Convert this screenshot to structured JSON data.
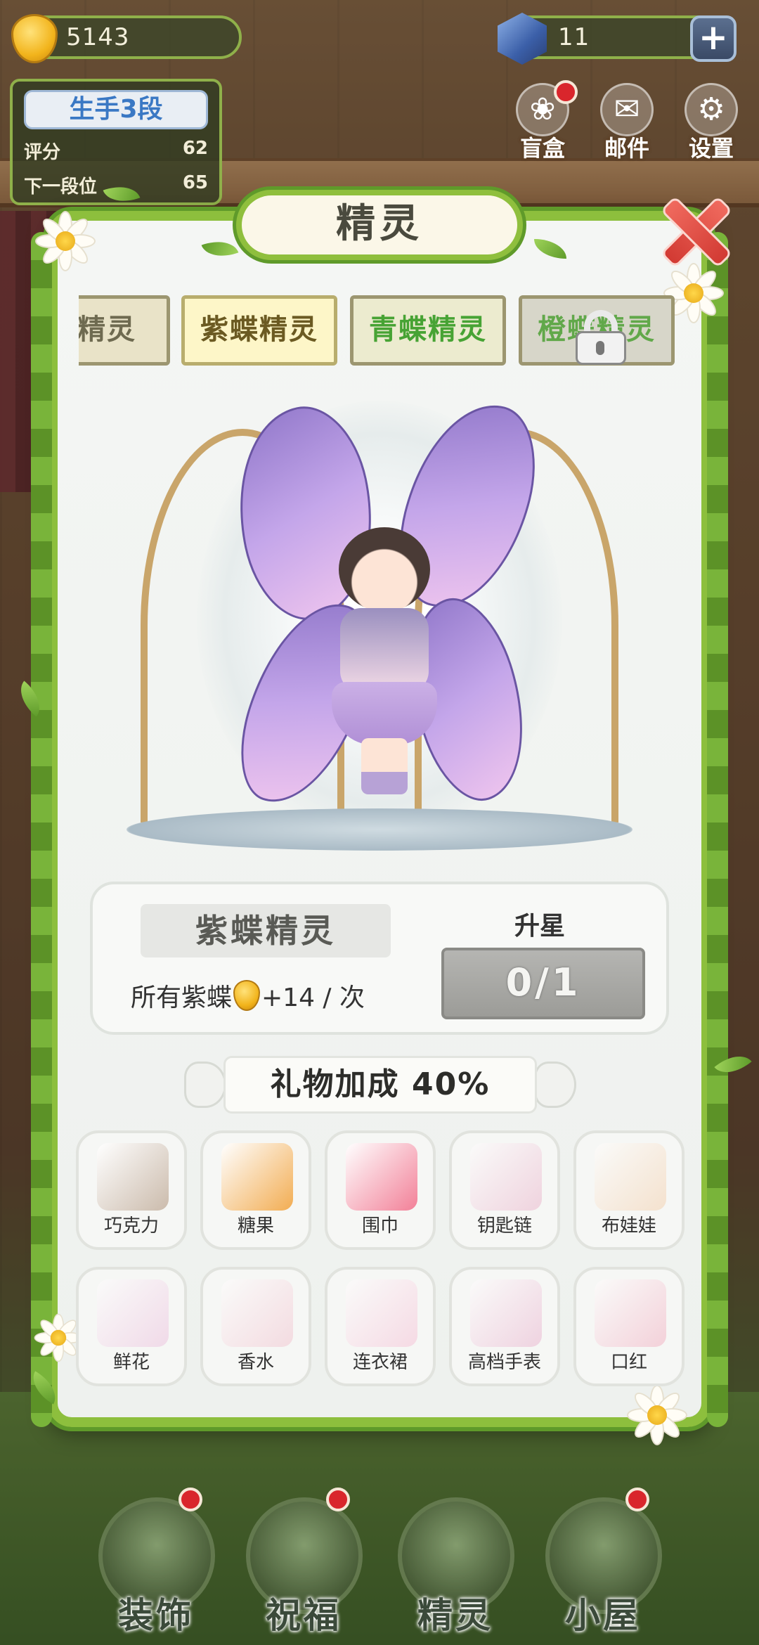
{
  "hud": {
    "coins": "5143",
    "gems": "11",
    "plus": "+"
  },
  "rank": {
    "title": "生手3段",
    "score_label": "评分",
    "score_value": "62",
    "next_label": "下一段位",
    "next_value": "65"
  },
  "top_icons": [
    {
      "label": "盲盒",
      "icon": "gift-box-icon",
      "badge": true
    },
    {
      "label": "邮件",
      "icon": "mail-icon",
      "badge": false
    },
    {
      "label": "设置",
      "icon": "gear-icon",
      "badge": false
    }
  ],
  "modal": {
    "title": "精灵",
    "tabs": [
      {
        "label": "蝶精灵",
        "state": "normal"
      },
      {
        "label": "紫蝶精灵",
        "state": "active"
      },
      {
        "label": "青蝶精灵",
        "state": "normal"
      },
      {
        "label": "橙蝶精灵",
        "state": "locked"
      }
    ],
    "info": {
      "name": "紫蝶精灵",
      "bonus_prefix": "所有紫蝶",
      "bonus_suffix": "+14 / 次",
      "star_label": "升星",
      "star_progress": "0/1"
    },
    "gift_bonus": "礼物加成 40%",
    "gifts": [
      {
        "name": "巧克力",
        "icon": "chocolate-icon",
        "owned": true,
        "color": "#c9b8a8"
      },
      {
        "name": "糖果",
        "icon": "candy-jar-icon",
        "owned": true,
        "color": "#f2a94a"
      },
      {
        "name": "围巾",
        "icon": "scarf-icon",
        "owned": true,
        "color": "#f27a93"
      },
      {
        "name": "钥匙链",
        "icon": "keychain-icon",
        "owned": false,
        "color": "#e7a7c2"
      },
      {
        "name": "布娃娃",
        "icon": "doll-icon",
        "owned": false,
        "color": "#f2c79e"
      },
      {
        "name": "鲜花",
        "icon": "flower-bouquet-icon",
        "owned": false,
        "color": "#e9b6d8"
      },
      {
        "name": "香水",
        "icon": "perfume-icon",
        "owned": false,
        "color": "#f0b9c7"
      },
      {
        "name": "连衣裙",
        "icon": "dress-icon",
        "owned": false,
        "color": "#f4b6cf"
      },
      {
        "name": "高档手表",
        "icon": "watch-icon",
        "owned": false,
        "color": "#e6a6c6"
      },
      {
        "name": "口红",
        "icon": "lipstick-icon",
        "owned": false,
        "color": "#f0a2b7"
      }
    ]
  },
  "bottom_nav": [
    {
      "label": "装饰",
      "icon": "potted-plant-icon",
      "badge": true
    },
    {
      "label": "祝福",
      "icon": "blessing-icon",
      "badge": true
    },
    {
      "label": "精灵",
      "icon": "fairy-icon",
      "badge": false
    },
    {
      "label": "小屋",
      "icon": "house-icon",
      "badge": true
    }
  ]
}
